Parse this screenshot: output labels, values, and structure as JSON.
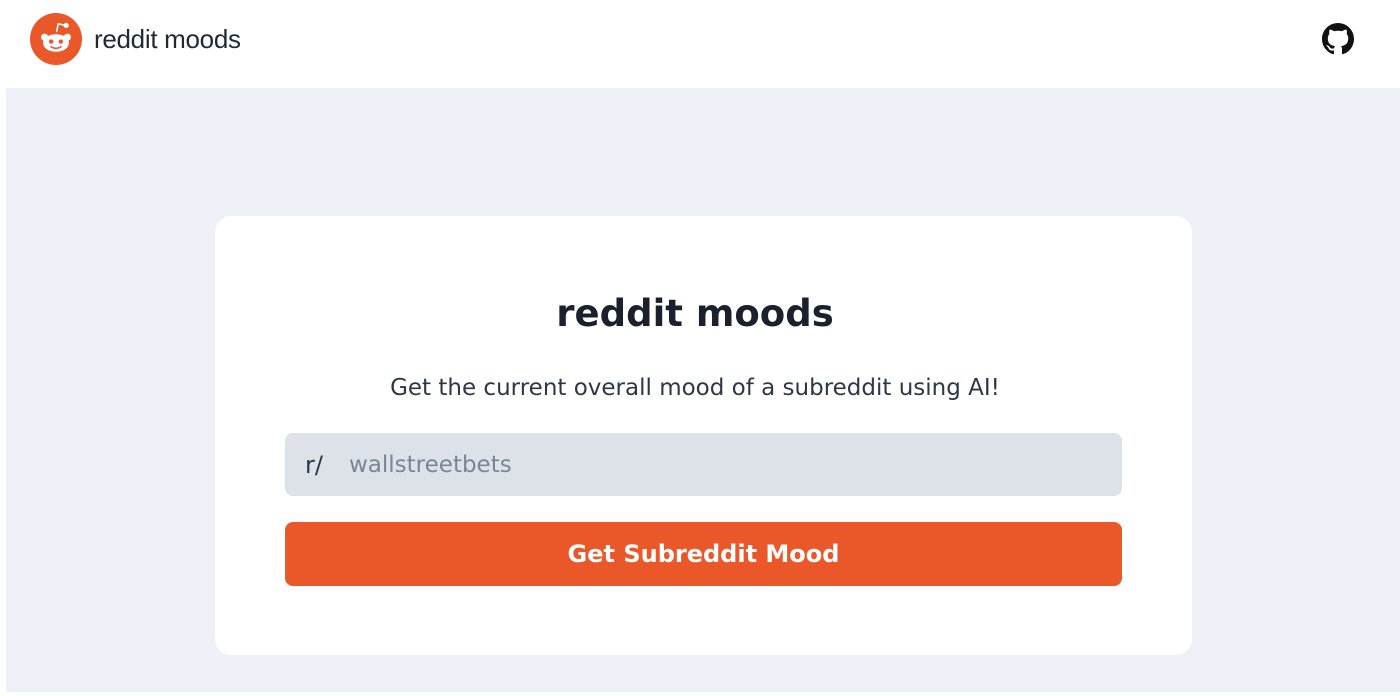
{
  "header": {
    "brand_name": "reddit moods",
    "logo_icon": "reddit-alien-icon",
    "github_icon": "github-icon"
  },
  "card": {
    "title": "reddit moods",
    "subtitle": "Get the current overall mood of a subreddit using AI!",
    "input": {
      "prefix": "r/",
      "placeholder": "wallstreetbets",
      "value": ""
    },
    "submit_label": "Get Subreddit Mood"
  },
  "colors": {
    "brand_orange": "#ea5729",
    "page_background": "#edf1f7",
    "input_background": "#dde2e9",
    "card_background": "#ffffff",
    "text_dark": "#1a202c"
  }
}
